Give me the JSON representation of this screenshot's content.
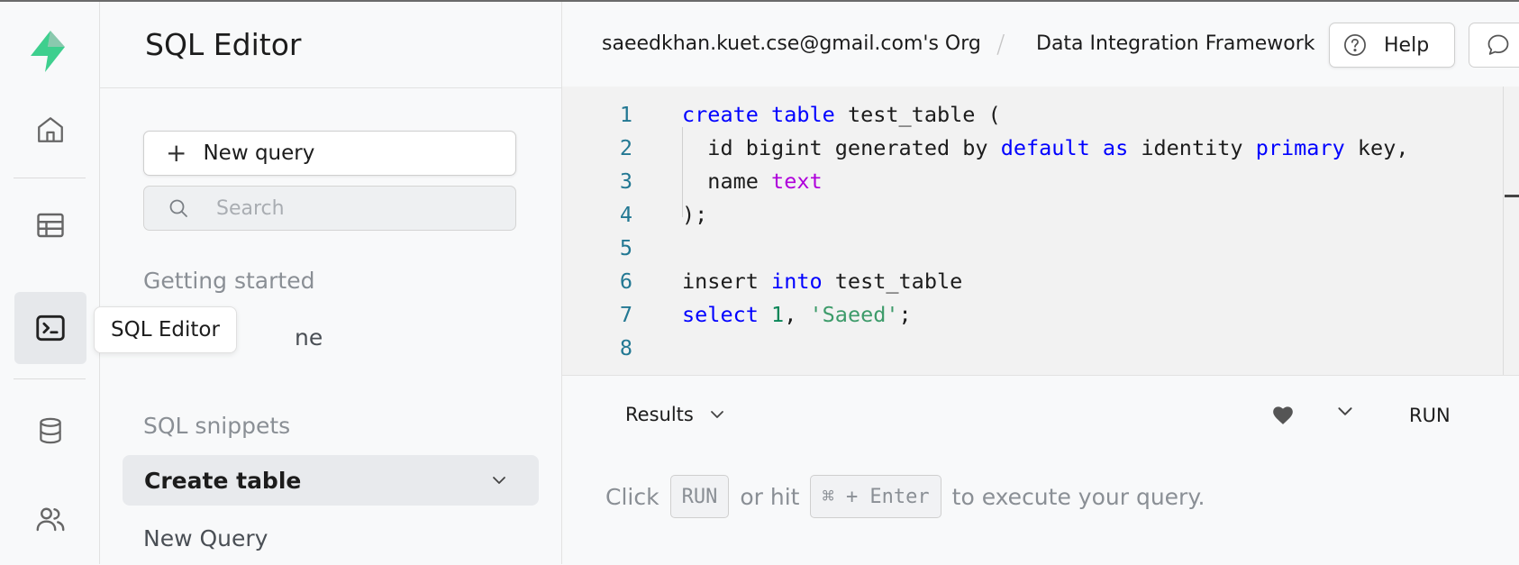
{
  "rail": {
    "tooltip": "SQL Editor"
  },
  "sidebar": {
    "title": "SQL Editor",
    "new_query_label": "New query",
    "search_placeholder": "Search",
    "getting_started": "Getting started",
    "getting_started_item_partial": "ne",
    "snippets_label": "SQL snippets",
    "snippets": [
      {
        "label": "Create table",
        "active": true
      },
      {
        "label": "New Query",
        "active": false
      }
    ]
  },
  "topbar": {
    "org": "saeedkhan.kuet.cse@gmail.com's Org",
    "separator": "/",
    "project": "Data Integration Framework",
    "help_label": "Help"
  },
  "editor": {
    "line_numbers": [
      "1",
      "2",
      "3",
      "4",
      "5",
      "6",
      "7",
      "8"
    ]
  },
  "results": {
    "tab_label": "Results",
    "run_label": "RUN",
    "hint_click": "Click",
    "hint_run_key": "RUN",
    "hint_or_hit": "or hit",
    "hint_shortcut": "⌘ + Enter",
    "hint_tail": "to execute your query."
  },
  "colors": {
    "brand": "#3ecf8e",
    "keyword": "#0000ff",
    "type": "#af00db",
    "number": "#098658",
    "string": "#3d9b6a",
    "line_number": "#237893"
  }
}
